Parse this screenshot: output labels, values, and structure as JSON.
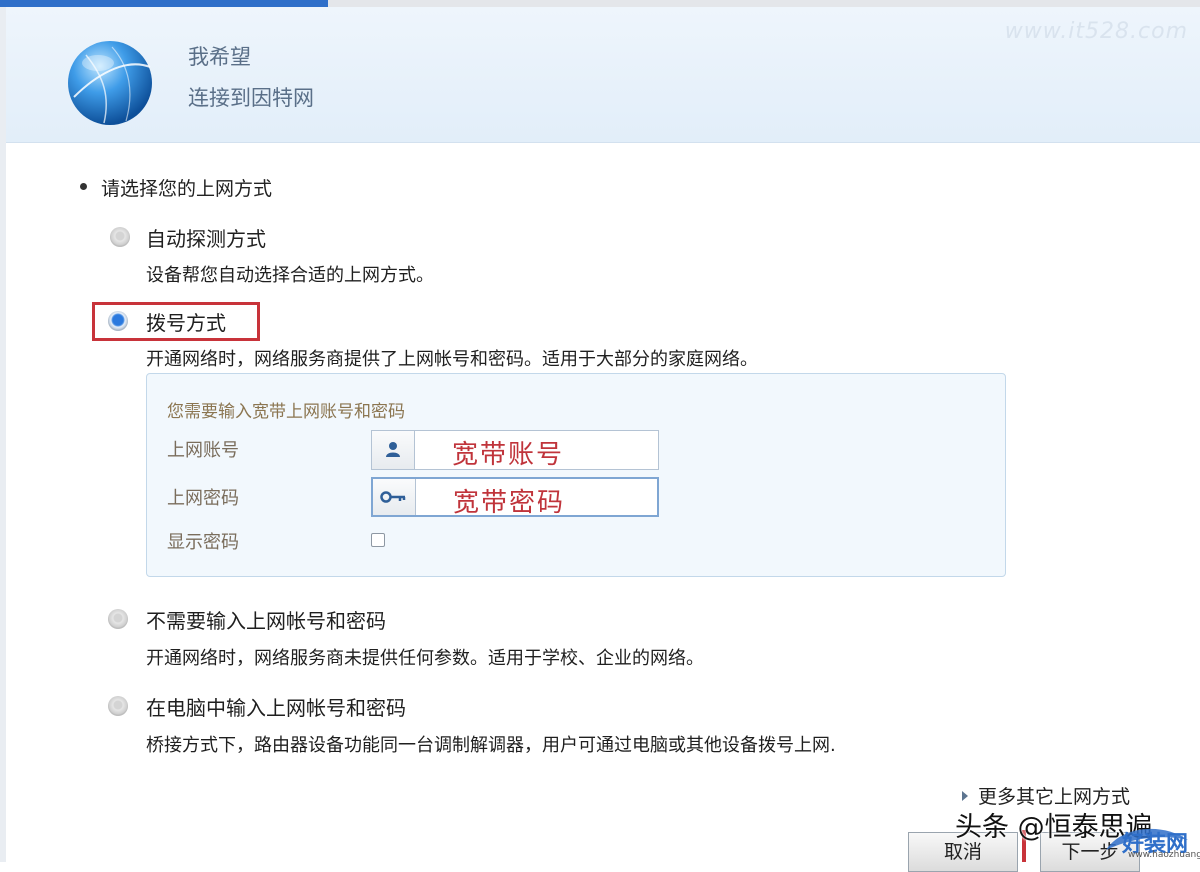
{
  "header": {
    "line1": "我希望",
    "line2": "连接到因特网",
    "watermark": "www.it528.com"
  },
  "prompt": "请选择您的上网方式",
  "options": [
    {
      "label": "自动探测方式",
      "desc": "设备帮您自动选择合适的上网方式。",
      "selected": false
    },
    {
      "label": "拨号方式",
      "desc": "开通网络时，网络服务商提供了上网帐号和密码。适用于大部分的家庭网络。",
      "selected": true
    },
    {
      "label": "不需要输入上网帐号和密码",
      "desc": "开通网络时，网络服务商未提供任何参数。适用于学校、企业的网络。",
      "selected": false
    },
    {
      "label": "在电脑中输入上网帐号和密码",
      "desc": "桥接方式下，路由器设备功能同一台调制解调器，用户可通过电脑或其他设备拨号上网.",
      "selected": false
    }
  ],
  "panel": {
    "title": "您需要输入宽带上网账号和密码",
    "account_label": "上网账号",
    "account_value": "宽带账号",
    "password_label": "上网密码",
    "password_value": "宽带密码",
    "show_password_label": "显示密码",
    "show_password_checked": false
  },
  "more_link": "更多其它上网方式",
  "buttons": {
    "cancel": "取消",
    "next": "下一步"
  },
  "watermark_bottom": "头条 @恒泰思遍",
  "brand": {
    "name": "好装网",
    "sub": "www.haozhuang.com"
  },
  "colors": {
    "accent": "#2f6fc9",
    "highlight": "#c8333a",
    "value_text": "#c0343b"
  }
}
